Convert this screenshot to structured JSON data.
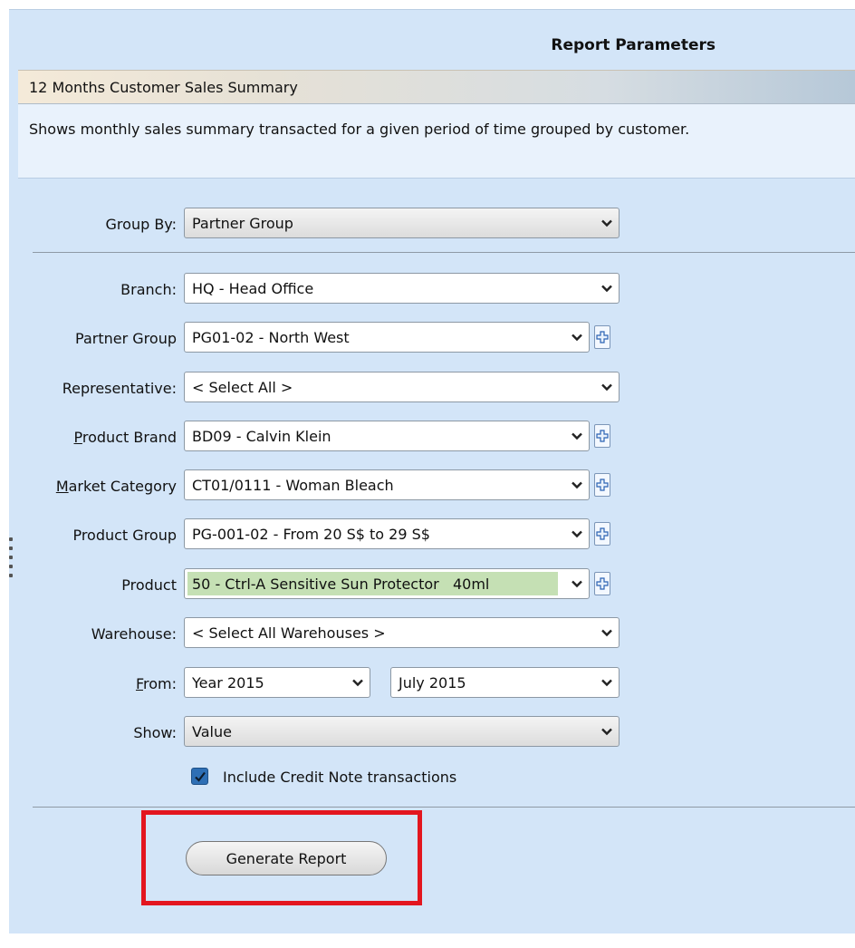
{
  "panel": {
    "title": "Report Parameters"
  },
  "report": {
    "name": "12 Months Customer Sales Summary",
    "description": "Shows monthly sales summary transacted for a given period of time grouped by customer."
  },
  "fields": {
    "group_by": {
      "label": "Group By:",
      "value": "Partner Group"
    },
    "branch": {
      "label": "Branch:",
      "value": "HQ - Head Office"
    },
    "partner_group": {
      "label": "Partner Group",
      "value": "PG01-02 - North West"
    },
    "representative": {
      "label": "Representative:",
      "value": "< Select All >"
    },
    "product_brand": {
      "label_mnemonic": "P",
      "label_rest": "roduct Brand",
      "value": "BD09 - Calvin Klein"
    },
    "market_category": {
      "label_mnemonic": "M",
      "label_rest": "arket Category",
      "value": "CT01/0111 - Woman Bleach"
    },
    "product_group": {
      "label": "Product Group",
      "value": "PG-001-02 - From 20 S$ to 29 S$"
    },
    "product": {
      "label": "Product",
      "value": "50 - Ctrl-A Sensitive Sun Protector   40ml"
    },
    "warehouse": {
      "label": "Warehouse:",
      "value": "< Select All Warehouses >"
    },
    "from": {
      "label_mnemonic": "F",
      "label_rest": "rom:",
      "year": "Year 2015",
      "month": "July 2015"
    },
    "show": {
      "label": "Show:",
      "value": "Value"
    }
  },
  "include_credit_note": {
    "label": "Include Credit Note transactions",
    "checked": true
  },
  "generate_button": {
    "label": "Generate Report"
  },
  "colors": {
    "highlight": "#e3161f",
    "panel_bg": "#d3e5f8",
    "product_bg": "#c5e0b4"
  }
}
